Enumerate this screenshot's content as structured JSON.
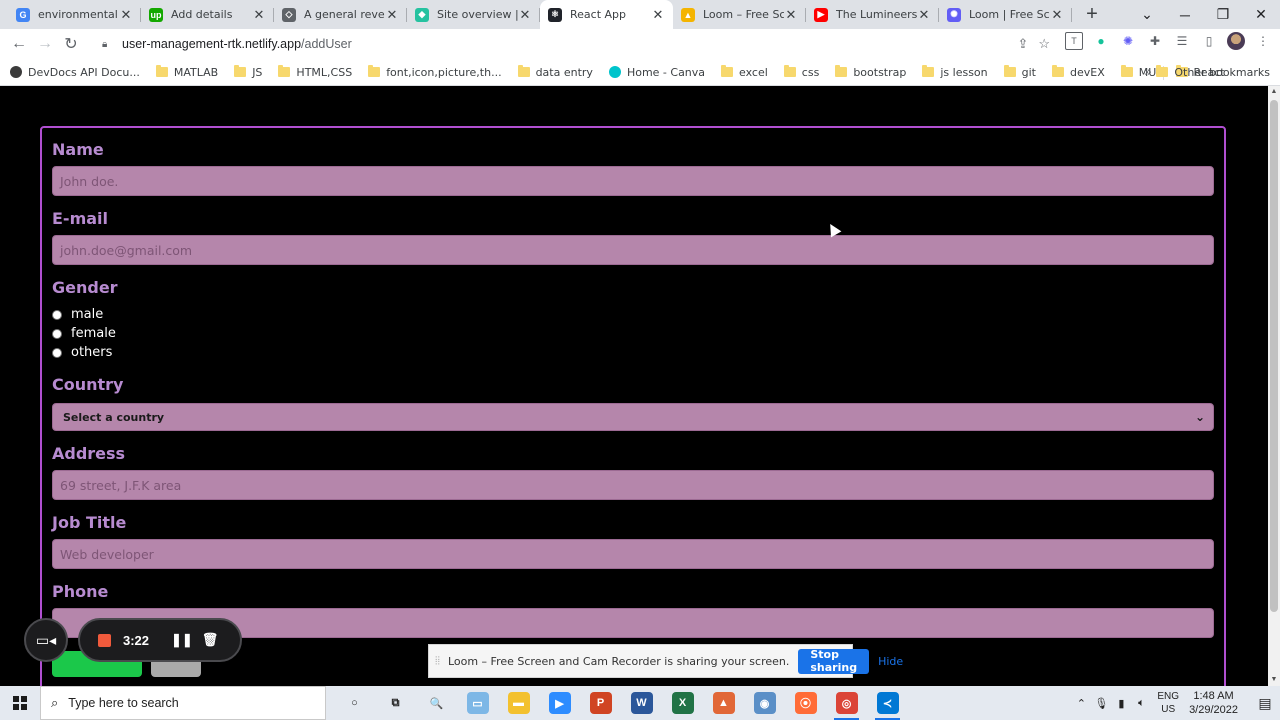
{
  "tabs": [
    {
      "title": "environmental fac",
      "icon": "google-icon",
      "color": "#4285f4",
      "glyph": "G",
      "active": false
    },
    {
      "title": "Add details",
      "icon": "upwork-icon",
      "color": "#14a800",
      "glyph": "up",
      "active": false
    },
    {
      "title": "A general reverse",
      "icon": "document-icon",
      "color": "#5f6368",
      "glyph": "◇",
      "active": false
    },
    {
      "title": "Site overview | us",
      "icon": "netlify-icon",
      "color": "#25c2a0",
      "glyph": "◆",
      "active": false
    },
    {
      "title": "React App",
      "icon": "react-icon",
      "color": "#20232a",
      "glyph": "⚛",
      "active": true
    },
    {
      "title": "Loom – Free Scre",
      "icon": "loom-drive-icon",
      "color": "#f4b400",
      "glyph": "▲",
      "active": false
    },
    {
      "title": "The Lumineers - S",
      "icon": "youtube-icon",
      "color": "#ff0000",
      "glyph": "▶",
      "active": false
    },
    {
      "title": "Loom | Free Scre",
      "icon": "loom-icon",
      "color": "#625df5",
      "glyph": "✺",
      "active": false
    }
  ],
  "toolbar": {
    "url_host": "user-management-rtk.netlify.app",
    "url_path": "/addUser"
  },
  "bookmarks": [
    {
      "label": "DevDocs API Docu...",
      "icon": "devdocs-icon"
    },
    {
      "label": "MATLAB",
      "icon": "folder-icon"
    },
    {
      "label": "JS",
      "icon": "folder-icon"
    },
    {
      "label": "HTML,CSS",
      "icon": "folder-icon"
    },
    {
      "label": "font,icon,picture,th...",
      "icon": "folder-icon"
    },
    {
      "label": "data entry",
      "icon": "folder-icon"
    },
    {
      "label": "Home - Canva",
      "icon": "canva-icon"
    },
    {
      "label": "excel",
      "icon": "folder-icon"
    },
    {
      "label": "css",
      "icon": "folder-icon"
    },
    {
      "label": "bootstrap",
      "icon": "folder-icon"
    },
    {
      "label": "js lesson",
      "icon": "folder-icon"
    },
    {
      "label": "git",
      "icon": "folder-icon"
    },
    {
      "label": "devEX",
      "icon": "folder-icon"
    },
    {
      "label": "MUI",
      "icon": "folder-icon"
    },
    {
      "label": "React",
      "icon": "folder-icon"
    }
  ],
  "other_bookmarks": "Other bookmarks",
  "form": {
    "name_label": "Name",
    "name_placeholder": "John doe.",
    "email_label": "E-mail",
    "email_placeholder": "john.doe@gmail.com",
    "gender_label": "Gender",
    "gender_options": [
      "male",
      "female",
      "others"
    ],
    "country_label": "Country",
    "country_selected": "Select a country",
    "address_label": "Address",
    "address_placeholder": "69 street, J.F.K area",
    "job_label": "Job Title",
    "job_placeholder": "Web developer",
    "phone_label": "Phone"
  },
  "loom": {
    "timer": "3:22",
    "share_message": "Loom – Free Screen and Cam Recorder is sharing your screen.",
    "stop_label": "Stop sharing",
    "hide_label": "Hide"
  },
  "taskbar": {
    "search_placeholder": "Type here to search",
    "lang_top": "ENG",
    "lang_bottom": "US",
    "time": "1:48 AM",
    "date": "3/29/2022",
    "apps": [
      {
        "name": "cortana-icon",
        "glyph": "○",
        "color": "transparent",
        "fg": "#222"
      },
      {
        "name": "task-view-icon",
        "glyph": "⧉",
        "color": "transparent",
        "fg": "#222"
      },
      {
        "name": "search-app-icon",
        "glyph": "🔍",
        "color": "transparent",
        "fg": "#e07b00"
      },
      {
        "name": "photos-icon",
        "glyph": "▭",
        "color": "#7db7e6",
        "fg": "#fff"
      },
      {
        "name": "file-explorer-icon",
        "glyph": "▬",
        "color": "#f3c12f",
        "fg": "#fff"
      },
      {
        "name": "zoom-icon",
        "glyph": "▶",
        "color": "#2d8cff",
        "fg": "#fff"
      },
      {
        "name": "powerpoint-icon",
        "glyph": "P",
        "color": "#d04423",
        "fg": "#fff"
      },
      {
        "name": "word-icon",
        "glyph": "W",
        "color": "#2b579a",
        "fg": "#fff"
      },
      {
        "name": "excel-icon",
        "glyph": "X",
        "color": "#217346",
        "fg": "#fff"
      },
      {
        "name": "matlab-icon",
        "glyph": "▲",
        "color": "#e16737",
        "fg": "#fff"
      },
      {
        "name": "globe-icon",
        "glyph": "◉",
        "color": "#5a8fc7",
        "fg": "#fff"
      },
      {
        "name": "postman-icon",
        "glyph": "⦿",
        "color": "#ff6c37",
        "fg": "#fff"
      },
      {
        "name": "chrome-icon",
        "glyph": "◎",
        "color": "#db4437",
        "fg": "#fff"
      },
      {
        "name": "vscode-icon",
        "glyph": "≺",
        "color": "#0078d4",
        "fg": "#fff"
      }
    ]
  }
}
